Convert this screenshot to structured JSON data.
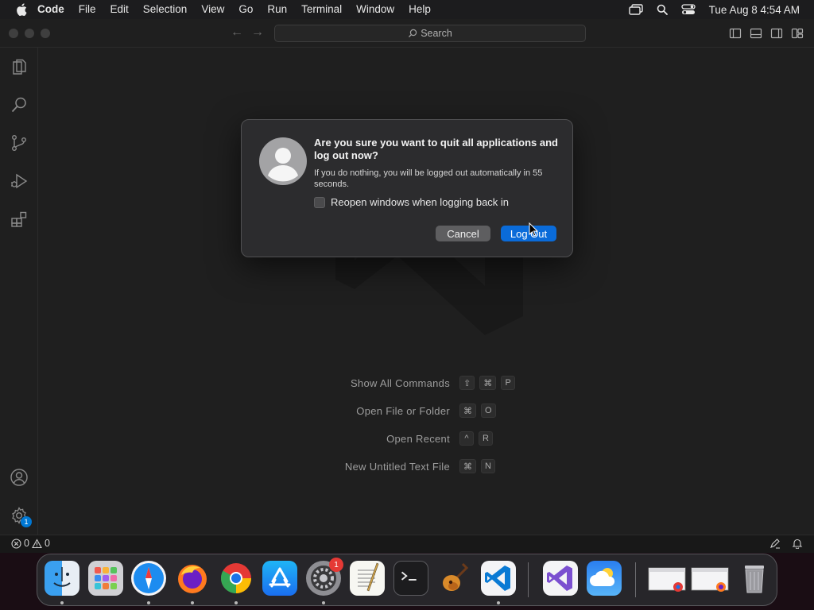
{
  "menubar": {
    "app_name": "Code",
    "items": [
      "File",
      "Edit",
      "Selection",
      "View",
      "Go",
      "Run",
      "Terminal",
      "Window",
      "Help"
    ],
    "clock": "Tue Aug 8  4:54 AM"
  },
  "titlebar": {
    "search_label": "Search"
  },
  "activitybar": {
    "items": [
      "explorer-icon",
      "search-icon",
      "source-control-icon",
      "run-debug-icon",
      "extensions-icon"
    ],
    "settings_badge": "1"
  },
  "editor": {
    "commands": [
      {
        "label": "Show All Commands",
        "keys": [
          "⇧",
          "⌘",
          "P"
        ]
      },
      {
        "label": "Open File or Folder",
        "keys": [
          "⌘",
          "O"
        ]
      },
      {
        "label": "Open Recent",
        "keys": [
          "^",
          "R"
        ]
      },
      {
        "label": "New Untitled Text File",
        "keys": [
          "⌘",
          "N"
        ]
      }
    ]
  },
  "statusbar": {
    "errors": "0",
    "warnings": "0"
  },
  "dialog": {
    "title": "Are you sure you want to quit all applications and log out now?",
    "message": "If you do nothing, you will be logged out automatically in 55 seconds.",
    "checkbox_label": "Reopen windows when logging back in",
    "checkbox_checked": false,
    "cancel_label": "Cancel",
    "primary_label": "Log Out"
  },
  "dock": {
    "apps": [
      "Finder",
      "Launchpad",
      "Safari",
      "Firefox",
      "Google Chrome",
      "App Store",
      "System Settings",
      "TextEdit",
      "Terminal",
      "GarageBand",
      "Visual Studio Code",
      "Visual Studio",
      "Weather"
    ],
    "system_settings_badge": "1"
  },
  "colors": {
    "accent": "#0a6bd9",
    "editor_bg": "#1f1f1f",
    "badge": "#e53935"
  }
}
